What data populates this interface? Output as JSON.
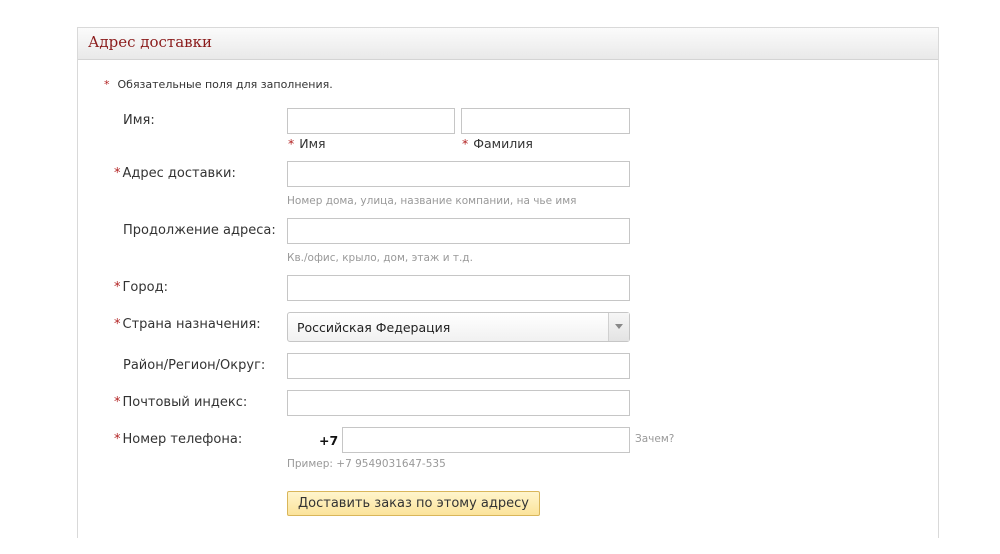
{
  "panel": {
    "title": "Адрес доставки"
  },
  "required_note": {
    "marker": "*",
    "text": "Обязательные поля для заполнения."
  },
  "form": {
    "name": {
      "label": "Имя:",
      "first": {
        "value": "",
        "sublabel": "Имя",
        "marker": "*"
      },
      "last": {
        "value": "",
        "sublabel": "Фамилия",
        "marker": "*"
      }
    },
    "address": {
      "marker": "*",
      "label": "Адрес доставки:",
      "value": "",
      "hint": "Номер дома, улица, название компании, на чье имя"
    },
    "address2": {
      "label": "Продолжение адреса:",
      "value": "",
      "hint": "Кв./офис, крыло, дом, этаж и т.д."
    },
    "city": {
      "marker": "*",
      "label": "Город:",
      "value": ""
    },
    "country": {
      "marker": "*",
      "label": "Страна назначения:",
      "selected": "Российская Федерация"
    },
    "region": {
      "label": "Район/Регион/Округ:",
      "value": ""
    },
    "zip": {
      "marker": "*",
      "label": "Почтовый индекс:",
      "value": ""
    },
    "phone": {
      "marker": "*",
      "label": "Номер телефона:",
      "prefix": "+7",
      "value": "",
      "why_link": "Зачем?",
      "hint": "Пример: +7 9549031647-535"
    }
  },
  "submit": {
    "label": "Доставить заказ по этому адресу"
  },
  "colors": {
    "title": "#8b1c1c",
    "required": "#b22222",
    "hint": "#999999",
    "button_bg": "#fbe39b",
    "button_border": "#d9b65a"
  },
  "icons": {
    "dropdown": "triangle-down-icon"
  }
}
